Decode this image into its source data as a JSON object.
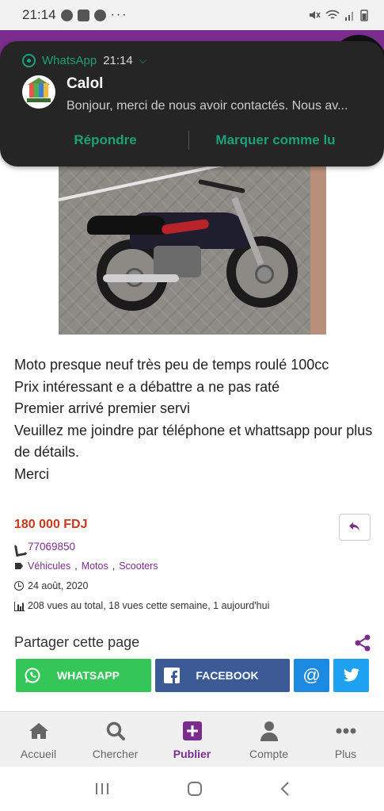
{
  "status_bar": {
    "time": "21:14",
    "more": "···"
  },
  "notification": {
    "app": "WhatsApp",
    "time": "21:14",
    "sender": "Calol",
    "message": "Bonjour, merci de nous avoir contactés. Nous av...",
    "action_reply": "Répondre",
    "action_mark_read": "Marquer comme lu"
  },
  "listing": {
    "description": [
      "Moto presque neuf très peu de temps roulé 100cc",
      "Prix intéressant e a débattre a ne pas raté",
      "Premier arrivé premier servi",
      "Veuillez me joindre par téléphone et whattsapp pour plus de détails.",
      "Merci"
    ],
    "price": "180 000 FDJ",
    "phone": "77069850",
    "categories": [
      "Véhicules",
      "Motos",
      "Scooters"
    ],
    "category_sep": ",",
    "date": "24 août, 2020",
    "views": "208 vues au total, 18 vues cette semaine, 1 aujourd'hui"
  },
  "share": {
    "title": "Partager cette page",
    "whatsapp_label": "WHATSAPP",
    "facebook_label": "FACEBOOK",
    "mail_label": "@"
  },
  "bottom_nav": {
    "items": [
      {
        "label": "Accueil",
        "icon": "home-icon"
      },
      {
        "label": "Chercher",
        "icon": "search-icon"
      },
      {
        "label": "Publier",
        "icon": "plus-icon"
      },
      {
        "label": "Compte",
        "icon": "user-icon"
      },
      {
        "label": "Plus",
        "icon": "more-icon"
      }
    ],
    "active_index": 2
  },
  "colors": {
    "brand_purple": "#7b2d8e",
    "price_red": "#c73a1b",
    "whatsapp_green": "#34c659",
    "facebook_blue": "#3b5a96",
    "notif_green": "#1aa17a"
  }
}
